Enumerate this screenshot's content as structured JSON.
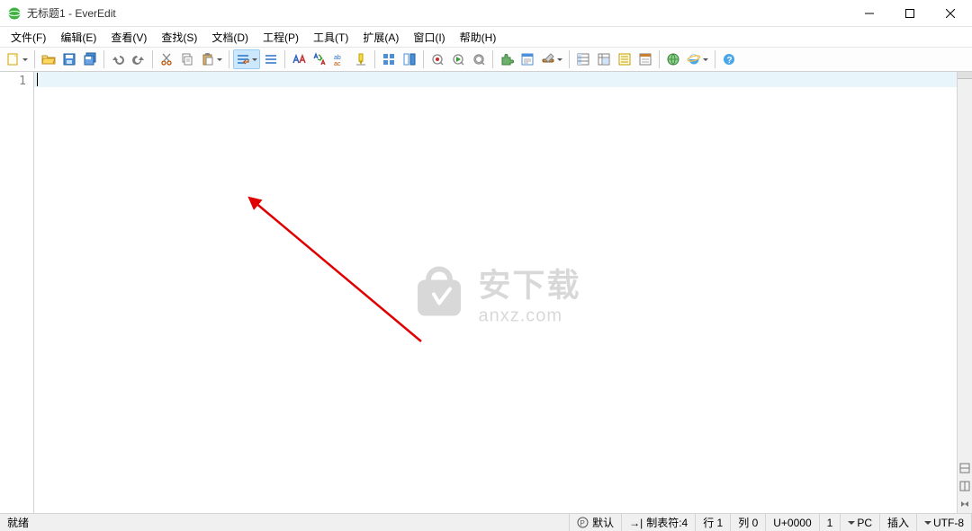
{
  "title": "无标题1 - EverEdit",
  "menus": [
    "文件(F)",
    "编辑(E)",
    "查看(V)",
    "查找(S)",
    "文档(D)",
    "工程(P)",
    "工具(T)",
    "扩展(A)",
    "窗口(I)",
    "帮助(H)"
  ],
  "toolbar_icons": [
    "new-file",
    "open-file",
    "save",
    "save-all",
    "sep",
    "undo",
    "redo",
    "sep",
    "cut",
    "copy",
    "paste",
    "sep",
    "word-wrap",
    "show-symbol",
    "sep",
    "find",
    "replace",
    "highlight",
    "mark",
    "sep",
    "bookmark",
    "split",
    "sep",
    "toggle-panel",
    "toggle-panel-2",
    "sep",
    "macro-record",
    "macro-play",
    "macro-stop",
    "sep",
    "plugin",
    "doc-map",
    "tools",
    "sep",
    "col-select",
    "outline",
    "char-map",
    "hex",
    "sep",
    "browser",
    "ie",
    "sep",
    "help"
  ],
  "line_number": "1",
  "statusbar": {
    "ready": "就绪",
    "default": "默认",
    "tab": "制表符:4",
    "row": "行 1",
    "col": "列 0",
    "unicode": "U+0000",
    "count": "1",
    "lineend": "PC",
    "insert": "插入",
    "encoding": "UTF-8"
  },
  "watermark": {
    "cn": "安下载",
    "en": "anxz.com"
  }
}
